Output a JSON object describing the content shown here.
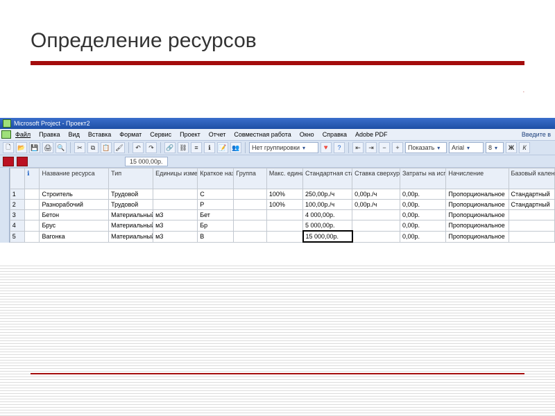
{
  "slide": {
    "title": "Определение ресурсов"
  },
  "app": {
    "title": "Microsoft Project - Проект2",
    "menu": {
      "file": "Файл",
      "edit": "Правка",
      "view": "Вид",
      "insert": "Вставка",
      "format": "Формат",
      "tools": "Сервис",
      "project": "Проект",
      "report": "Отчет",
      "collab": "Совместная работа",
      "window": "Окно",
      "help": "Справка",
      "pdf": "Adobe PDF",
      "right_hint": "Введите в"
    },
    "toolbar": {
      "grouping_label": "Нет группировки",
      "show_label": "Показать",
      "font_name": "Arial",
      "font_size": "8",
      "bold": "Ж",
      "italic": "К"
    },
    "formula_value": "15 000,00р.",
    "columns": {
      "info": "",
      "name": "Название ресурса",
      "type": "Тип",
      "unit": "Единицы измерения материалов",
      "short": "Краткое название",
      "group": "Группа",
      "max": "Макс. единиц",
      "rate": "Стандартная ставка",
      "overtime": "Ставка сверхурочных",
      "cost": "Затраты на использ.",
      "accrual": "Начисление",
      "calendar": "Базовый календарь"
    },
    "rows": [
      {
        "n": "1",
        "name": "Строитель",
        "type": "Трудовой",
        "unit": "",
        "short": "С",
        "group": "",
        "max": "100%",
        "rate": "250,00р./ч",
        "over": "0,00р./ч",
        "cost": "0,00р.",
        "accr": "Пропорциональное",
        "cal": "Стандартный"
      },
      {
        "n": "2",
        "name": "Разнорабочий",
        "type": "Трудовой",
        "unit": "",
        "short": "Р",
        "group": "",
        "max": "100%",
        "rate": "100,00р./ч",
        "over": "0,00р./ч",
        "cost": "0,00р.",
        "accr": "Пропорциональное",
        "cal": "Стандартный"
      },
      {
        "n": "3",
        "name": "Бетон",
        "type": "Материальный",
        "unit": "м3",
        "short": "Бет",
        "group": "",
        "max": "",
        "rate": "4 000,00р.",
        "over": "",
        "cost": "0,00р.",
        "accr": "Пропорциональное",
        "cal": ""
      },
      {
        "n": "4",
        "name": "Брус",
        "type": "Материальный",
        "unit": "м3",
        "short": "Бр",
        "group": "",
        "max": "",
        "rate": "5 000,00р.",
        "over": "",
        "cost": "0,00р.",
        "accr": "Пропорциональное",
        "cal": ""
      },
      {
        "n": "5",
        "name": "Вагонка",
        "type": "Материальный",
        "unit": "м3",
        "short": "В",
        "group": "",
        "max": "",
        "rate": "15 000,00р.",
        "over": "",
        "cost": "0,00р.",
        "accr": "Пропорциональное",
        "cal": ""
      }
    ],
    "selected_cell": {
      "row": 4,
      "col": "rate"
    }
  }
}
